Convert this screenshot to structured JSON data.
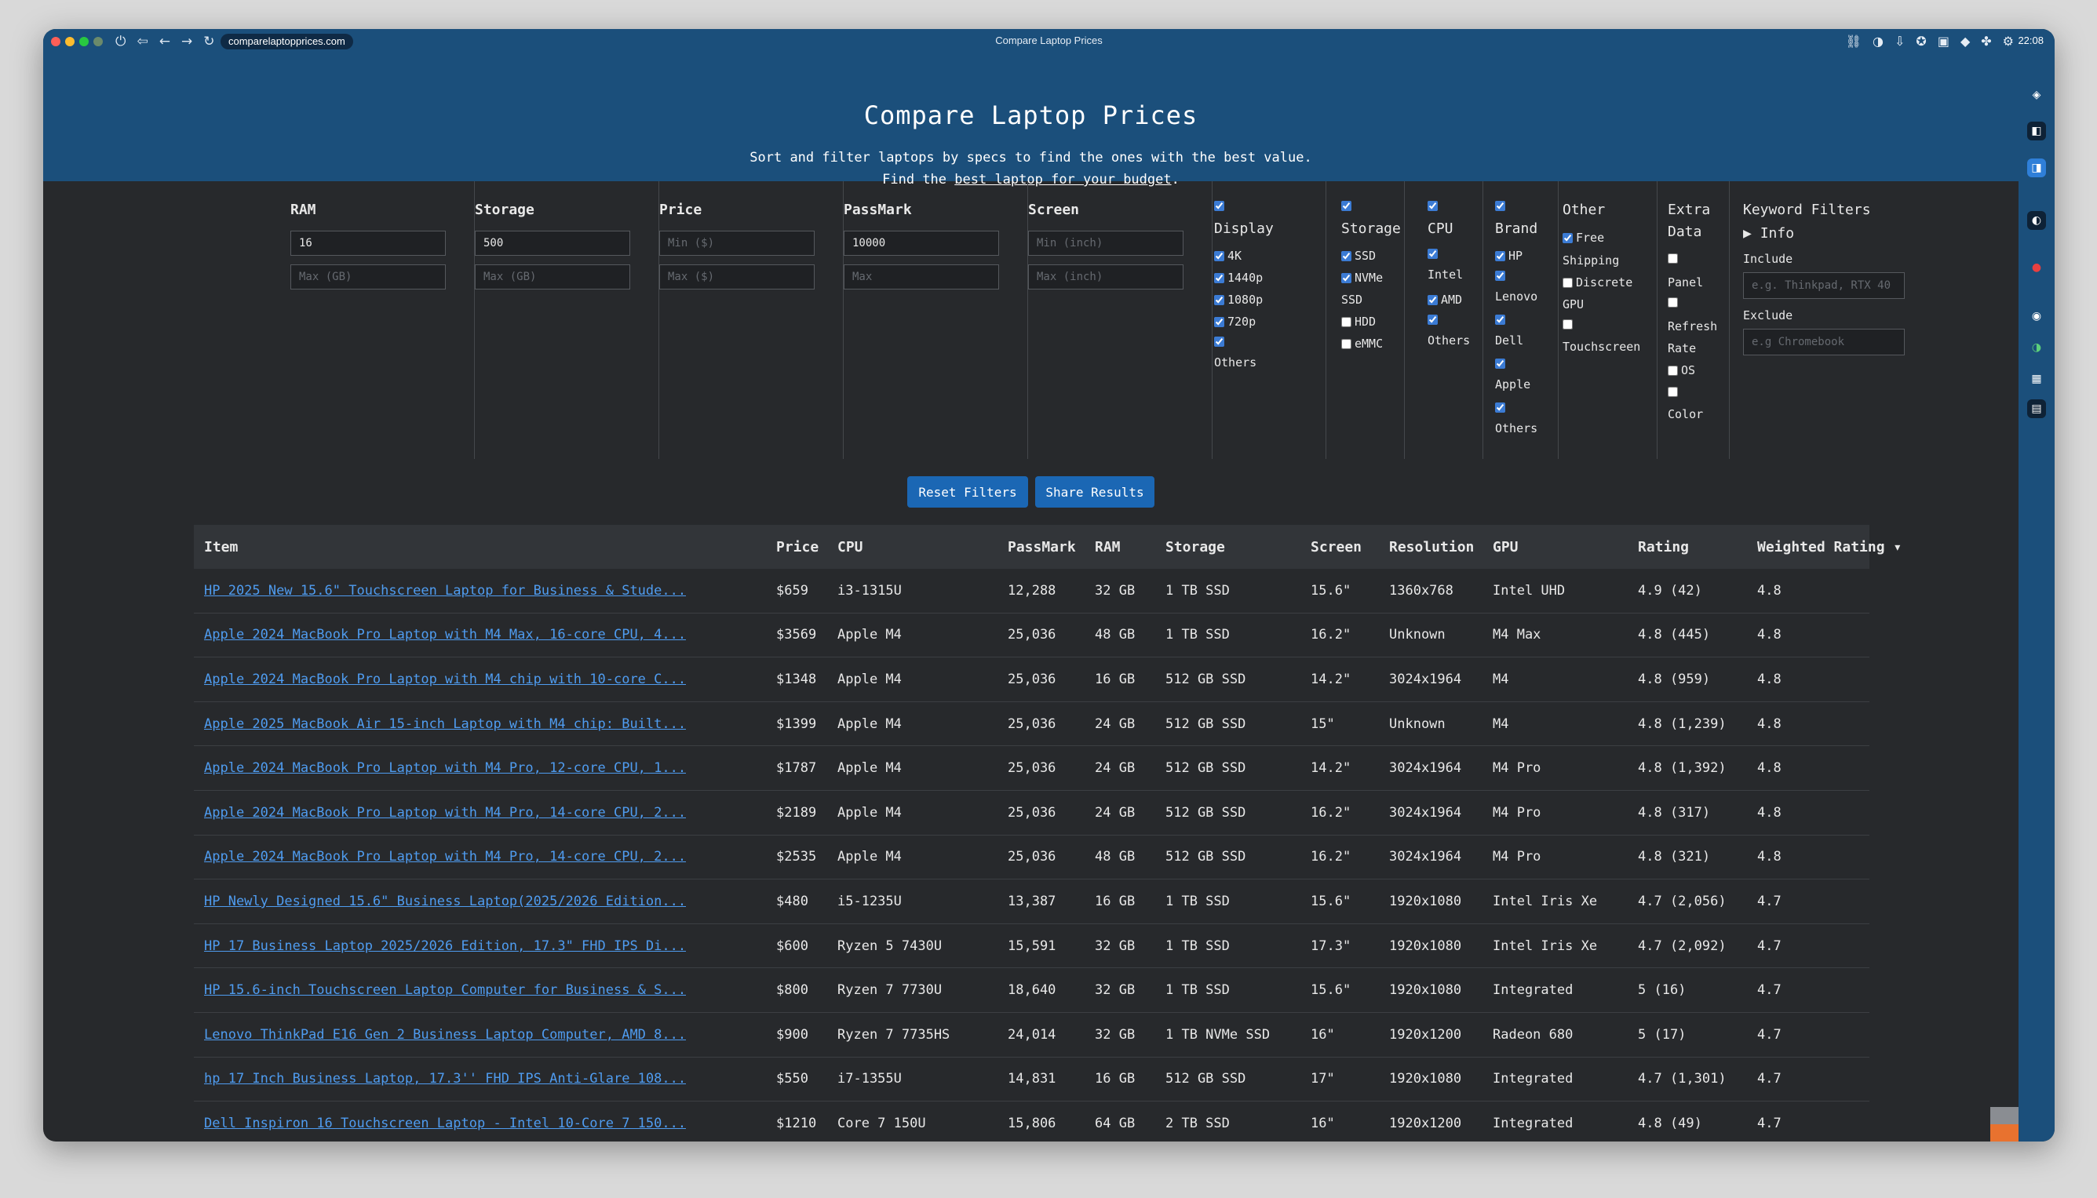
{
  "browser": {
    "url": "comparelaptopprices.com",
    "window_title": "Compare Laptop Prices",
    "clock": "22:08",
    "colors": {
      "bar": "#1b4f7b",
      "panel": "#27292c",
      "accent": "#1b67b4",
      "link": "#4f9cf0"
    }
  },
  "header": {
    "title": "Compare Laptop Prices",
    "subtitle_line1": "Sort and filter laptops by specs to find the ones with the best value.",
    "subtitle_pre": "Find the ",
    "subtitle_link": "best laptop for your budget",
    "subtitle_post": "."
  },
  "filters": {
    "ram": {
      "label": "RAM",
      "min_value": "16",
      "max_placeholder": "Max (GB)"
    },
    "storage": {
      "label": "Storage",
      "min_value": "500",
      "max_placeholder": "Max (GB)"
    },
    "price": {
      "label": "Price",
      "min_placeholder": "Min ($)",
      "max_placeholder": "Max ($)"
    },
    "passmark": {
      "label": "PassMark",
      "min_value": "10000",
      "max_placeholder": "Max"
    },
    "screen": {
      "label": "Screen",
      "min_placeholder": "Min (inch)",
      "max_placeholder": "Max (inch)"
    },
    "display": {
      "label": "Display",
      "options": [
        {
          "label": "4K",
          "checked": true
        },
        {
          "label": "1440p",
          "checked": true
        },
        {
          "label": "1080p",
          "checked": true
        },
        {
          "label": "720p",
          "checked": true
        },
        {
          "label": "Others",
          "checked": true
        }
      ]
    },
    "storage_type": {
      "label": "Storage",
      "options": [
        {
          "label": "SSD",
          "checked": true
        },
        {
          "label": "NVMe",
          "checked": true,
          "line2": "SSD"
        },
        {
          "label": "HDD",
          "checked": false
        },
        {
          "label": "eMMC",
          "checked": false
        }
      ]
    },
    "cpu": {
      "label": "CPU",
      "options": [
        {
          "label": "Intel",
          "checked": true
        },
        {
          "label": "AMD",
          "checked": true
        },
        {
          "label": "Others",
          "checked": true
        }
      ]
    },
    "brand": {
      "label": "Brand",
      "options": [
        {
          "label": "HP",
          "checked": true
        },
        {
          "label": "Lenovo",
          "checked": true
        },
        {
          "label": "Dell",
          "checked": true
        },
        {
          "label": "Apple",
          "checked": true
        },
        {
          "label": "Others",
          "checked": true
        }
      ]
    },
    "other": {
      "label": "Other",
      "free": "Free",
      "shipping": "Shipping",
      "discrete": "Discrete",
      "gpu": "GPU",
      "touchscreen": "Touchscreen"
    },
    "extra": {
      "label_line1": "Extra",
      "label_line2": "Data",
      "panel": "Panel",
      "refresh": "Refresh",
      "rate": "Rate",
      "os": "OS",
      "color": "Color"
    },
    "keyword": {
      "label": "Keyword Filters",
      "info": "Info",
      "include_label": "Include",
      "include_placeholder": "e.g. Thinkpad, RTX 40",
      "exclude_label": "Exclude",
      "exclude_placeholder": "e.g Chromebook"
    }
  },
  "buttons": {
    "reset": "Reset Filters",
    "share": "Share Results"
  },
  "table": {
    "headers": {
      "item": "Item",
      "price": "Price",
      "cpu": "CPU",
      "passmark": "PassMark",
      "ram": "RAM",
      "storage": "Storage",
      "screen": "Screen",
      "resolution": "Resolution",
      "gpu": "GPU",
      "rating": "Rating",
      "weighted": "Weighted Rating ▾"
    },
    "rows": [
      {
        "item": "HP 2025 New 15.6\" Touchscreen Laptop for Business & Stude...",
        "price": "$659",
        "cpu": "i3-1315U",
        "passmark": "12,288",
        "ram": "32 GB",
        "storage": "1 TB SSD",
        "screen": "15.6\"",
        "resolution": "1360x768",
        "gpu": "Intel UHD",
        "rating": "4.9 (42)",
        "weighted": "4.8"
      },
      {
        "item": "Apple 2024 MacBook Pro Laptop with M4 Max, 16-core CPU, 4...",
        "price": "$3569",
        "cpu": "Apple M4",
        "passmark": "25,036",
        "ram": "48 GB",
        "storage": "1 TB SSD",
        "screen": "16.2\"",
        "resolution": "Unknown",
        "gpu": "M4 Max",
        "rating": "4.8 (445)",
        "weighted": "4.8"
      },
      {
        "item": "Apple 2024 MacBook Pro Laptop with M4 chip with 10-core C...",
        "price": "$1348",
        "cpu": "Apple M4",
        "passmark": "25,036",
        "ram": "16 GB",
        "storage": "512 GB SSD",
        "screen": "14.2\"",
        "resolution": "3024x1964",
        "gpu": "M4",
        "rating": "4.8 (959)",
        "weighted": "4.8"
      },
      {
        "item": "Apple 2025 MacBook Air 15-inch Laptop with M4 chip: Built...",
        "price": "$1399",
        "cpu": "Apple M4",
        "passmark": "25,036",
        "ram": "24 GB",
        "storage": "512 GB SSD",
        "screen": "15\"",
        "resolution": "Unknown",
        "gpu": "M4",
        "rating": "4.8 (1,239)",
        "weighted": "4.8"
      },
      {
        "item": "Apple 2024 MacBook Pro Laptop with M4 Pro, 12-core CPU, 1...",
        "price": "$1787",
        "cpu": "Apple M4",
        "passmark": "25,036",
        "ram": "24 GB",
        "storage": "512 GB SSD",
        "screen": "14.2\"",
        "resolution": "3024x1964",
        "gpu": "M4 Pro",
        "rating": "4.8 (1,392)",
        "weighted": "4.8"
      },
      {
        "item": "Apple 2024 MacBook Pro Laptop with M4 Pro, 14-core CPU, 2...",
        "price": "$2189",
        "cpu": "Apple M4",
        "passmark": "25,036",
        "ram": "24 GB",
        "storage": "512 GB SSD",
        "screen": "16.2\"",
        "resolution": "3024x1964",
        "gpu": "M4 Pro",
        "rating": "4.8 (317)",
        "weighted": "4.8"
      },
      {
        "item": "Apple 2024 MacBook Pro Laptop with M4 Pro, 14-core CPU, 2...",
        "price": "$2535",
        "cpu": "Apple M4",
        "passmark": "25,036",
        "ram": "48 GB",
        "storage": "512 GB SSD",
        "screen": "16.2\"",
        "resolution": "3024x1964",
        "gpu": "M4 Pro",
        "rating": "4.8 (321)",
        "weighted": "4.8"
      },
      {
        "item": "HP Newly Designed 15.6\" Business Laptop(2025/2026 Edition...",
        "price": "$480",
        "cpu": "i5-1235U",
        "passmark": "13,387",
        "ram": "16 GB",
        "storage": "1 TB SSD",
        "screen": "15.6\"",
        "resolution": "1920x1080",
        "gpu": "Intel Iris Xe",
        "rating": "4.7 (2,056)",
        "weighted": "4.7"
      },
      {
        "item": "HP 17 Business Laptop 2025/2026 Edition, 17.3\" FHD IPS Di...",
        "price": "$600",
        "cpu": "Ryzen 5 7430U",
        "passmark": "15,591",
        "ram": "32 GB",
        "storage": "1 TB SSD",
        "screen": "17.3\"",
        "resolution": "1920x1080",
        "gpu": "Intel Iris Xe",
        "rating": "4.7 (2,092)",
        "weighted": "4.7"
      },
      {
        "item": "HP 15.6-inch Touchscreen Laptop Computer for Business & S...",
        "price": "$800",
        "cpu": "Ryzen 7 7730U",
        "passmark": "18,640",
        "ram": "32 GB",
        "storage": "1 TB SSD",
        "screen": "15.6\"",
        "resolution": "1920x1080",
        "gpu": "Integrated",
        "rating": "5 (16)",
        "weighted": "4.7"
      },
      {
        "item": "Lenovo ThinkPad E16 Gen 2 Business Laptop Computer, AMD 8...",
        "price": "$900",
        "cpu": "Ryzen 7 7735HS",
        "passmark": "24,014",
        "ram": "32 GB",
        "storage": "1 TB NVMe SSD",
        "screen": "16\"",
        "resolution": "1920x1200",
        "gpu": "Radeon 680",
        "rating": "5 (17)",
        "weighted": "4.7"
      },
      {
        "item": "hp 17 Inch Business Laptop, 17.3'' FHD IPS Anti-Glare 108...",
        "price": "$550",
        "cpu": "i7-1355U",
        "passmark": "14,831",
        "ram": "16 GB",
        "storage": "512 GB SSD",
        "screen": "17\"",
        "resolution": "1920x1080",
        "gpu": "Integrated",
        "rating": "4.7 (1,301)",
        "weighted": "4.7"
      },
      {
        "item": "Dell Inspiron 16 Touchscreen Laptop - Intel 10-Core 7 150...",
        "price": "$1210",
        "cpu": "Core 7 150U",
        "passmark": "15,806",
        "ram": "64 GB",
        "storage": "2 TB SSD",
        "screen": "16\"",
        "resolution": "1920x1200",
        "gpu": "Integrated",
        "rating": "4.8 (49)",
        "weighted": "4.7"
      }
    ]
  }
}
